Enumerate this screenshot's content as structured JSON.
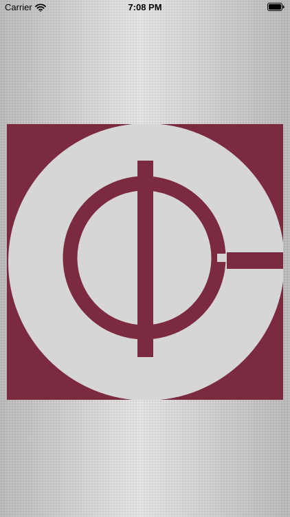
{
  "status_bar": {
    "carrier": "Carrier",
    "time": "7:08 PM",
    "wifi_icon": "wifi-icon",
    "battery_icon": "battery-icon"
  },
  "splash": {
    "logo_icon": "brand-logo",
    "brand_color": "#7b2a3f",
    "background_color": "#d7d7d7"
  }
}
